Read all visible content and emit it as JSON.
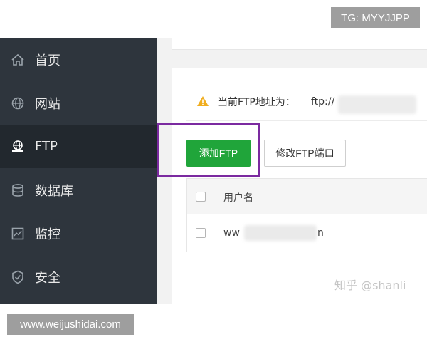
{
  "watermarks": {
    "tg": "TG: MYYJJPP",
    "url": "www.weijushidai.com",
    "zhihu": "知乎 @shanli"
  },
  "sidebar": {
    "items": [
      {
        "label": "首页",
        "icon": "home-icon",
        "active": false
      },
      {
        "label": "网站",
        "icon": "globe-icon",
        "active": false
      },
      {
        "label": "FTP",
        "icon": "ftp-icon",
        "active": true
      },
      {
        "label": "数据库",
        "icon": "database-icon",
        "active": false
      },
      {
        "label": "监控",
        "icon": "monitor-icon",
        "active": false
      },
      {
        "label": "安全",
        "icon": "shield-icon",
        "active": false
      }
    ]
  },
  "notice": {
    "icon": "warning-icon",
    "label": "当前FTP地址为：",
    "value": "ftp://"
  },
  "toolbar": {
    "add_label": "添加FTP",
    "port_label": "修改FTP端口"
  },
  "table": {
    "header": "用户名",
    "rows": [
      {
        "prefix": "ww",
        "suffix": "n"
      }
    ]
  },
  "colors": {
    "sidebar_bg": "#2e353d",
    "primary_green": "#20a53a",
    "highlight_purple": "#7b2aa0",
    "warning_amber": "#f0ad1e"
  }
}
